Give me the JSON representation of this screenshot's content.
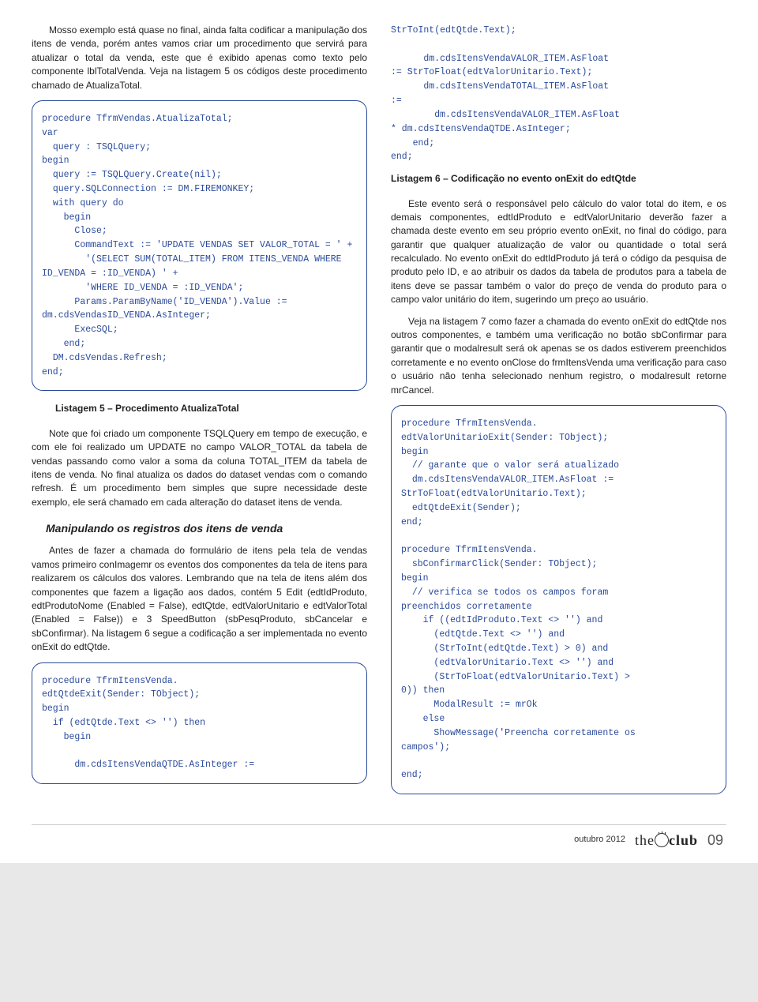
{
  "intro": "Mosso exemplo está quase no final, ainda falta codificar a manipulação dos itens de venda, porém antes vamos criar um procedimento que servirá para atualizar o total da venda, este que é exibido apenas como texto pelo componente lblTotalVenda. Veja na listagem 5 os códigos deste procedimento chamado de AtualizaTotal.",
  "code5": "procedure TfrmVendas.AtualizaTotal;\nvar\n  query : TSQLQuery;\nbegin\n  query := TSQLQuery.Create(nil);\n  query.SQLConnection := DM.FIREMONKEY;\n  with query do\n    begin\n      Close;\n      CommandText := 'UPDATE VENDAS SET VALOR_TOTAL = ' +\n        '(SELECT SUM(TOTAL_ITEM) FROM ITENS_VENDA WHERE ID_VENDA = :ID_VENDA) ' +\n        'WHERE ID_VENDA = :ID_VENDA';\n      Params.ParamByName('ID_VENDA').Value := dm.cdsVendasID_VENDA.AsInteger;\n      ExecSQL;\n    end;\n  DM.cdsVendas.Refresh;\nend;",
  "caption5": "Listagem 5 – Procedimento AtualizaTotal",
  "note": "Note que foi criado um componente TSQLQuery em tempo de execução, e com ele foi realizado um UPDATE no campo VALOR_TOTAL da tabela de vendas passando como valor a soma da coluna TOTAL_ITEM da tabela de itens de venda. No final atualiza os dados do dataset vendas com o comando refresh. É um procedimento bem simples que supre necessidade deste exemplo, ele será chamado em cada alteração do dataset itens de venda.",
  "subhead": "Manipulando os registros dos itens de venda",
  "before6": "Antes de fazer a chamada do formulário de itens pela tela de vendas vamos primeiro conImagemr os eventos dos componentes da tela de itens para realizarem os cálculos dos valores. Lembrando que na tela de itens além dos componentes que fazem a ligação aos dados, contém 5 Edit (edtIdProduto, edtProdutoNome (Enabled = False), edtQtde, edtValorUnitario e edtValorTotal (Enabled = False)) e 3 SpeedButton (sbPesqProduto, sbCancelar e sbConfirmar). Na listagem 6 segue a codificação a ser implementada no evento onExit do edtQtde.",
  "code6a": "procedure TfrmItensVenda.\nedtQtdeExit(Sender: TObject);\nbegin\n  if (edtQtde.Text <> '') then\n    begin\n\n      dm.cdsItensVendaQTDE.AsInteger :=",
  "code6b": "StrToInt(edtQtde.Text);\n\n      dm.cdsItensVendaVALOR_ITEM.AsFloat\n:= StrToFloat(edtValorUnitario.Text);\n      dm.cdsItensVendaTOTAL_ITEM.AsFloat\n:=\n        dm.cdsItensVendaVALOR_ITEM.AsFloat\n* dm.cdsItensVendaQTDE.AsInteger;\n    end;\nend;",
  "caption6": "Listagem 6 – Codificação no evento onExit do edtQtde",
  "after6a": "Este evento será o responsável pelo cálculo do valor total do item, e os demais componentes, edtIdProduto e edtValorUnitario deverão fazer a chamada deste evento em seu próprio evento onExit, no final do código, para garantir que qualquer atualização de valor ou quantidade o total  será recalculado. No evento onExit do edtIdProduto já terá o código da pesquisa de produto pelo ID, e ao atribuir os dados da tabela de produtos para a tabela de itens deve se passar também o valor do preço de venda do produto para o campo valor unitário do item, sugerindo um preço ao usuário.",
  "after6b": "Veja na listagem 7 como fazer a chamada do evento onExit do edtQtde nos outros componentes, e também uma verificação no botão sbConfirmar para garantir que o modalresult será ok apenas se os dados estiverem preenchidos corretamente e no evento onClose do frmItensVenda uma verificação para caso o usuário não tenha selecionado nenhum registro, o modalresult retorne mrCancel.",
  "code7": "procedure TfrmItensVenda.\nedtValorUnitarioExit(Sender: TObject);\nbegin\n  // garante que o valor será atualizado\n  dm.cdsItensVendaVALOR_ITEM.AsFloat :=\nStrToFloat(edtValorUnitario.Text);\n  edtQtdeExit(Sender);\nend;\n\nprocedure TfrmItensVenda.\n  sbConfirmarClick(Sender: TObject);\nbegin\n  // verifica se todos os campos foram\npreenchidos corretamente\n    if ((edtIdProduto.Text <> '') and\n      (edtQtde.Text <> '') and\n      (StrToInt(edtQtde.Text) > 0) and\n      (edtValorUnitario.Text <> '') and\n      (StrToFloat(edtValorUnitario.Text) >\n0)) then\n      ModalResult := mrOk\n    else\n      ShowMessage('Preencha corretamente os\ncampos');\n\nend;",
  "footer": {
    "date": "outubro 2012",
    "brand_the": "the",
    "brand_club": "club",
    "page": "09"
  }
}
